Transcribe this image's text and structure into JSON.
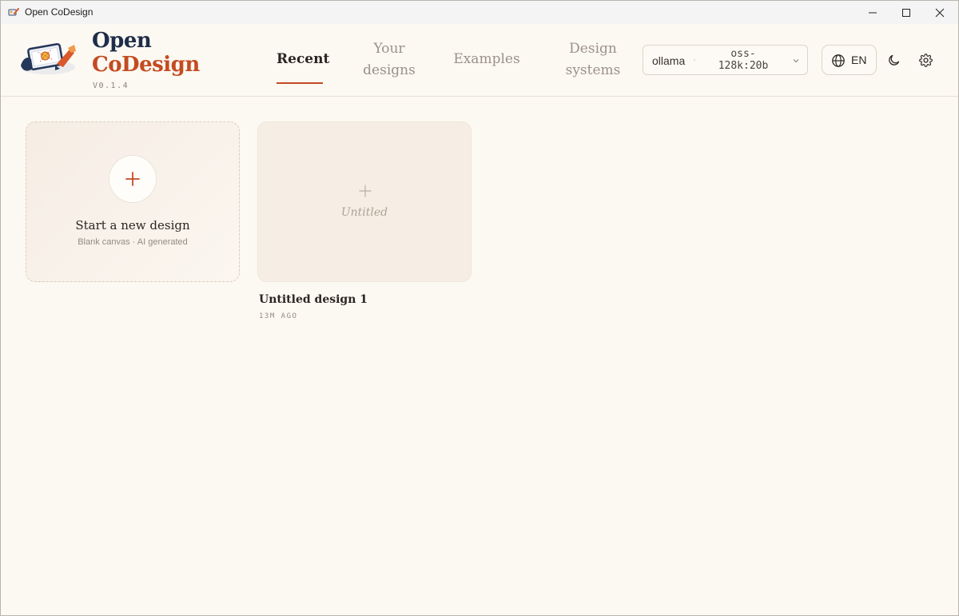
{
  "window": {
    "title": "Open CoDesign"
  },
  "brand": {
    "line1": "Open",
    "line2": "CoDesign",
    "version": "V0.1.4"
  },
  "nav": {
    "tabs": [
      {
        "label": "Recent",
        "active": true
      },
      {
        "label": "Your designs",
        "active": false
      },
      {
        "label": "Examples",
        "active": false
      },
      {
        "label": "Design systems",
        "active": false
      }
    ]
  },
  "model_select": {
    "provider": "ollama",
    "separator": "·",
    "model": "oss-128k:20b"
  },
  "language": {
    "label": "EN"
  },
  "icons": {
    "globe": "globe-icon",
    "theme": "moon-icon",
    "settings": "gear-icon"
  },
  "new_design": {
    "title": "Start a new design",
    "subtitle": "Blank canvas · AI generated"
  },
  "designs": [
    {
      "thumbnail_label": "Untitled",
      "name": "Untitled design 1",
      "time": "13M AGO"
    }
  ],
  "colors": {
    "background": "#fcf8f2",
    "accent": "#c44b21",
    "brand_navy": "#1e2d49"
  }
}
